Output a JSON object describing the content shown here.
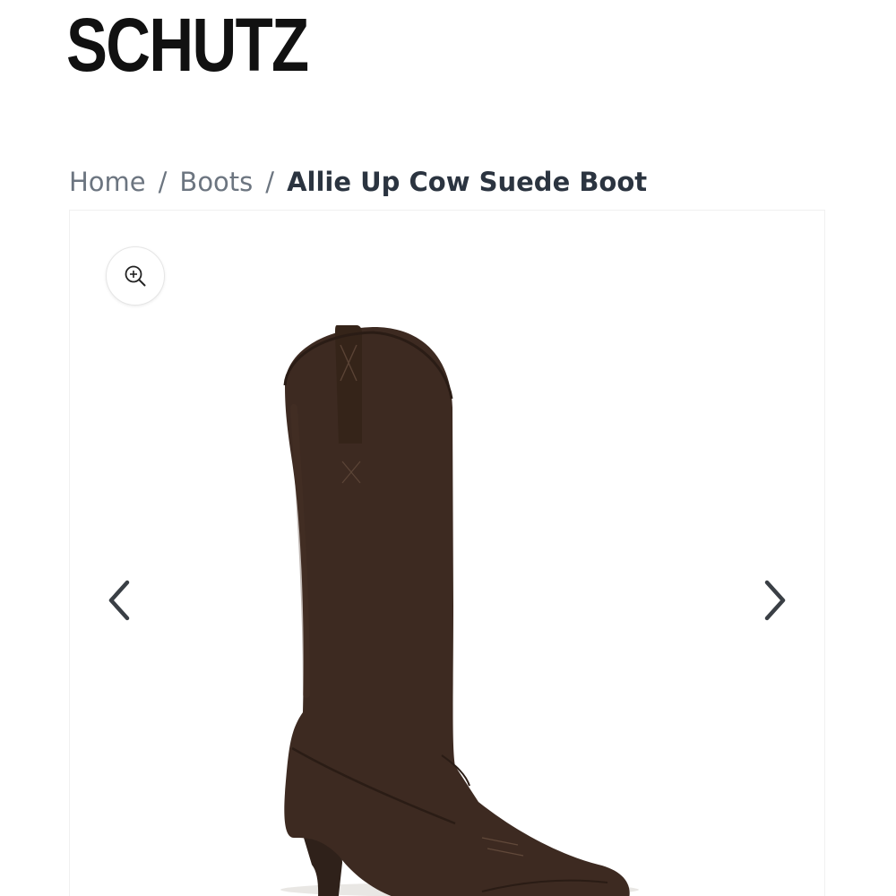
{
  "brand": {
    "logo_text": "SCHUTZ"
  },
  "breadcrumb": {
    "items": [
      {
        "label": "Home"
      },
      {
        "label": "Boots"
      }
    ],
    "separator": "/",
    "current": "Allie Up Cow Suede Boot"
  },
  "gallery": {
    "zoom_icon": "zoom-in-icon",
    "prev_icon": "chevron-left-icon",
    "next_icon": "chevron-right-icon",
    "product_color": "#3d2a21"
  }
}
